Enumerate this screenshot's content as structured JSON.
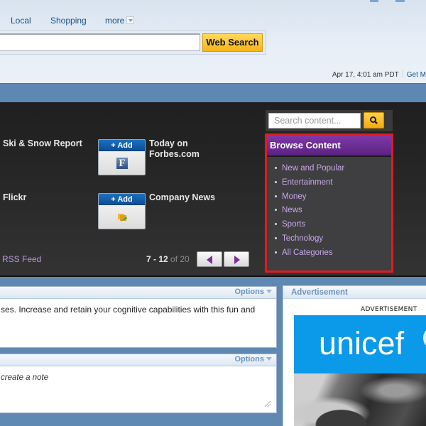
{
  "header": {
    "nav": [
      "Local",
      "Shopping",
      "more"
    ],
    "search": {
      "value": "",
      "placeholder": ""
    },
    "web_search_label": "Web Search",
    "date": "Apr 17, 4:01 am PDT",
    "get_link": "Get M"
  },
  "showcase": {
    "items": [
      {
        "title": "Ski & Snow Report"
      },
      {
        "title": "Today on Forbes.com",
        "add_label": "+ Add",
        "icon": "forbes-icon"
      },
      {
        "title": "Flickr"
      },
      {
        "title": "Company News",
        "add_label": "+ Add",
        "icon": "folder-icon"
      }
    ],
    "rss_label": "RSS Feed",
    "pager": {
      "range": "7 - 12",
      "of_label": "of 20"
    },
    "content_search": {
      "placeholder": "Search content..."
    },
    "browse": {
      "title": "Browse Content",
      "items": [
        "New and Popular",
        "Entertainment",
        "Money",
        "News",
        "Sports",
        "Technology",
        "All Categories"
      ]
    }
  },
  "modules": {
    "game": {
      "options_label": "Options",
      "text": "ses. Increase and retain your cognitive capabilities with this fun and"
    },
    "notes": {
      "options_label": "Options",
      "text": "create a note"
    },
    "ad": {
      "title": "Advertisement",
      "label": "ADVERTISEMENT",
      "brand": "unicef"
    }
  },
  "colors": {
    "accent_purple": "#5b2281",
    "highlight_red": "#e11b22",
    "search_yellow": "#f7b515",
    "band_blue": "#5d88b4"
  }
}
